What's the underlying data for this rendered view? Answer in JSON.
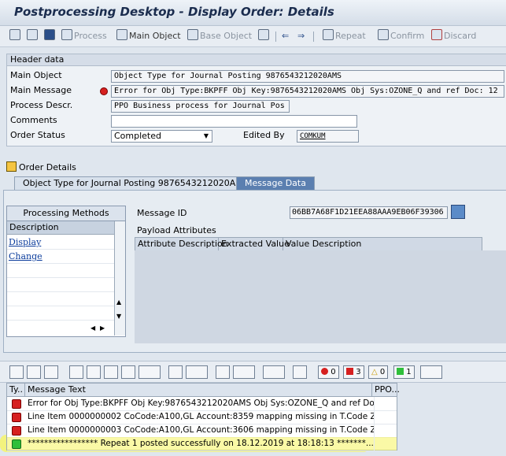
{
  "window": {
    "title": "Postprocessing Desktop - Display Order: Details"
  },
  "toolbar": {
    "process": "Process",
    "main_object": "Main Object",
    "base_object": "Base Object",
    "repeat": "Repeat",
    "confirm": "Confirm",
    "discard": "Discard"
  },
  "header": {
    "section_title": "Header data",
    "main_object_label": "Main Object",
    "main_object_value": "Object Type for Journal Posting 9876543212020AMS",
    "main_message_label": "Main Message",
    "main_message_value": "Error for Obj Type:BKPFF Obj Key:9876543212020AMS Obj Sys:OZONE_Q and ref Doc: 12",
    "process_descr_label": "Process Descr.",
    "process_descr_value": "PPO Business process for Journal Pos",
    "comments_label": "Comments",
    "comments_value": "",
    "order_status_label": "Order Status",
    "order_status_value": "Completed",
    "edited_by_label": "Edited By",
    "edited_by_value": "COMKUM"
  },
  "order_details": {
    "label": "Order Details",
    "tabs": [
      "Object Type for Journal Posting 9876543212020AMS",
      "Message Data"
    ],
    "active_tab": "Message Data"
  },
  "processing_methods": {
    "title": "Processing Methods",
    "column": "Description",
    "items": [
      "Display",
      "Change"
    ]
  },
  "message_data": {
    "message_id_label": "Message ID",
    "message_id_value": "06BB7A68F1D21EEA88AAA9EB06F39306",
    "payload_label": "Payload Attributes",
    "columns": [
      "Attribute Description",
      "Extracted Value",
      "Value Description"
    ]
  },
  "log_toolbar": {
    "stop_count": "0",
    "error_count": "3",
    "warning_count": "0",
    "success_count": "1"
  },
  "log": {
    "columns": [
      "Ty..",
      "Message Text",
      "PPO..."
    ],
    "rows": [
      {
        "type": "error",
        "text": "Error for Obj Type:BKPFF Obj Key:9876543212020AMS Obj Sys:OZONE_Q and ref Doc: ..."
      },
      {
        "type": "error",
        "text": "Line Item 0000000002 CoCode:A100,GL Account:8359 mapping missing in T.Code ZTC..."
      },
      {
        "type": "error",
        "text": "Line Item 0000000003 CoCode:A100,GL Account:3606 mapping missing in T.Code ZTC..."
      },
      {
        "type": "success",
        "text": "***************** Repeat 1 posted successfully on 18.12.2019 at 18:18:13 *******..."
      }
    ]
  },
  "colors": {
    "error": "#d62020",
    "success": "#2fbf3a",
    "highlight": "#f7f56a",
    "active_tab": "#5b7fb0"
  }
}
